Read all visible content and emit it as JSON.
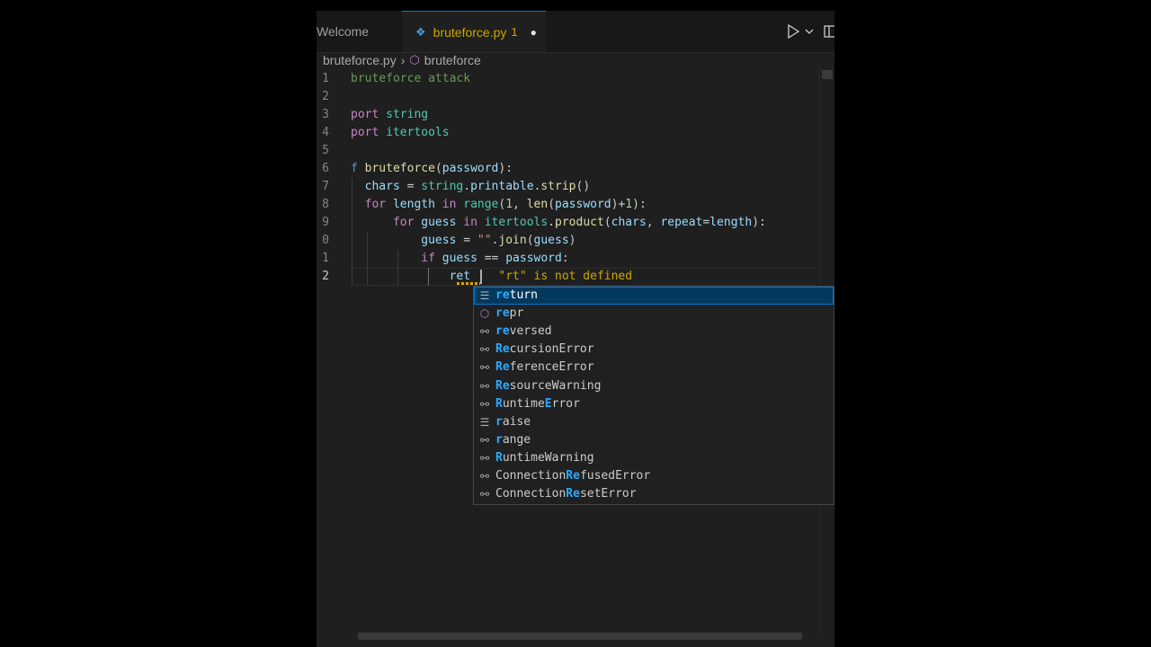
{
  "tabs": [
    {
      "label": "Welcome",
      "active": false
    },
    {
      "label": "bruteforce.py",
      "active": true,
      "badge": "1",
      "dirty": "●"
    }
  ],
  "breadcrumb": {
    "file": "bruteforce.py",
    "separator": "›",
    "symbol": "bruteforce"
  },
  "line_numbers": [
    "1",
    "2",
    "3",
    "4",
    "5",
    "6",
    "7",
    "8",
    "9",
    "0",
    "1",
    "2"
  ],
  "code": {
    "l1": "bruteforce attack",
    "l3_kw": "port",
    "l3_mod": "string",
    "l4_kw": "port",
    "l4_mod": "itertools",
    "l6_kw": "f",
    "l6_fn": "bruteforce",
    "l6_p1": "(",
    "l6_param": "password",
    "l6_p2": "):",
    "l7_var": "chars",
    "l7_eq": " = ",
    "l7_mod": "string",
    "l7_dot": ".",
    "l7_attr": "printable",
    "l7_dot2": ".",
    "l7_fn": "strip",
    "l7_par": "()",
    "l8_for": "for",
    "l8_var": "length",
    "l8_in": "in",
    "l8_fn": "range",
    "l8_p1": "(",
    "l8_n1": "1",
    "l8_c": ", ",
    "l8_len": "len",
    "l8_p2": "(",
    "l8_pw": "password",
    "l8_p3": ")+",
    "l8_n2": "1",
    "l8_p4": "):",
    "l9_for": "for",
    "l9_var": "guess",
    "l9_in": "in",
    "l9_mod": "itertools",
    "l9_dot": ".",
    "l9_fn": "product",
    "l9_p1": "(",
    "l9_a1": "chars",
    "l9_c": ", ",
    "l9_kwarg": "repeat",
    "l9_eq": "=",
    "l9_a2": "length",
    "l9_p2": "):",
    "l10_var": "guess",
    "l10_eq": " = ",
    "l10_str": "\"\"",
    "l10_dot": ".",
    "l10_fn": "join",
    "l10_p1": "(",
    "l10_arg": "guess",
    "l10_p2": ")",
    "l11_if": "if",
    "l11_a": "guess",
    "l11_op": " == ",
    "l11_b": "password",
    "l11_col": ":",
    "l12_typed": "ret",
    "l12_error": "\"rt\" is not defined"
  },
  "suggestions": [
    {
      "match": "re",
      "rest": "turn",
      "icon": "keyword-icon",
      "glyph": "☰",
      "selected": true
    },
    {
      "match": "re",
      "rest": "pr",
      "icon": "method-icon",
      "glyph": "⬡",
      "selected": false
    },
    {
      "match": "re",
      "rest": "versed",
      "icon": "variable-icon",
      "glyph": "⚯",
      "selected": false
    },
    {
      "match": "Re",
      "rest": "cursionError",
      "icon": "variable-icon",
      "glyph": "⚯",
      "selected": false
    },
    {
      "match": "Re",
      "rest": "ferenceError",
      "icon": "variable-icon",
      "glyph": "⚯",
      "selected": false
    },
    {
      "match": "Re",
      "rest": "sourceWarning",
      "icon": "variable-icon",
      "glyph": "⚯",
      "selected": false
    },
    {
      "pre": "",
      "match": "R",
      "mid": "untime",
      "match2": "E",
      "rest": "rror",
      "icon": "variable-icon",
      "glyph": "⚯",
      "selected": false
    },
    {
      "match": "r",
      "rest": "aise",
      "icon": "keyword-icon",
      "glyph": "☰",
      "selected": false
    },
    {
      "match": "r",
      "rest": "ange",
      "icon": "variable-icon",
      "glyph": "⚯",
      "selected": false
    },
    {
      "match": "R",
      "rest": "untimeWarning",
      "icon": "variable-icon",
      "glyph": "⚯",
      "selected": false
    },
    {
      "pre": "Connection",
      "match": "Re",
      "rest": "fusedError",
      "icon": "variable-icon",
      "glyph": "⚯",
      "selected": false
    },
    {
      "pre": "Connection",
      "match": "Re",
      "rest": "setError",
      "icon": "variable-icon",
      "glyph": "⚯",
      "selected": false
    }
  ]
}
